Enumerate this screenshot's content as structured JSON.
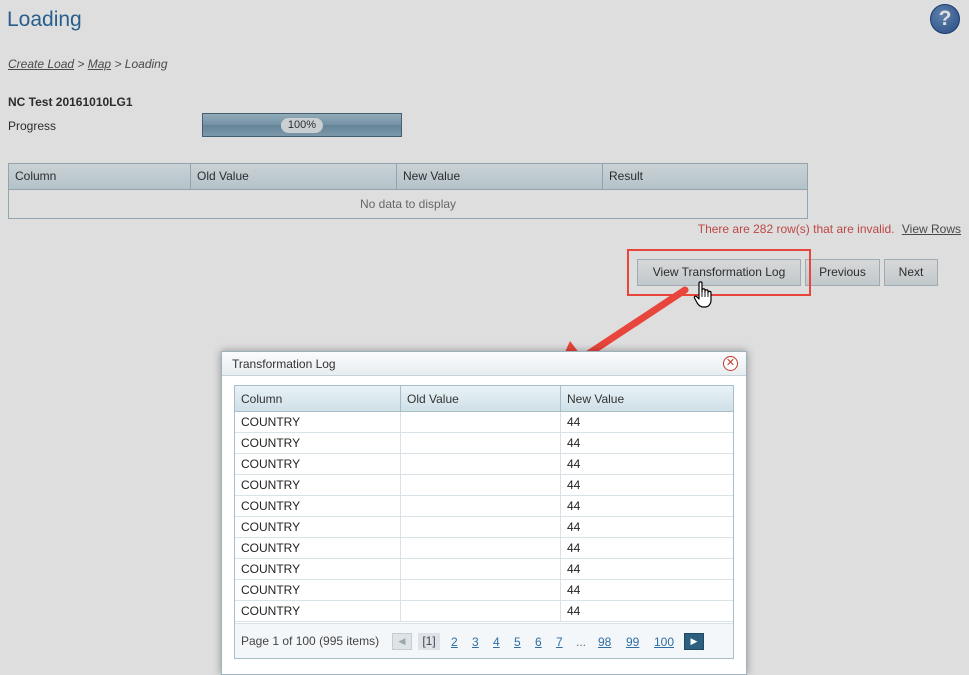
{
  "page": {
    "title": "Loading",
    "help_icon": "question-mark-icon"
  },
  "breadcrumb": {
    "items": [
      "Create Load",
      "Map"
    ],
    "separator": ">",
    "current": "Loading"
  },
  "load": {
    "name": "NC Test 20161010LG1",
    "progress_label": "Progress",
    "progress_value": 100,
    "progress_text": "100%"
  },
  "results_grid": {
    "columns": [
      "Column",
      "Old Value",
      "New Value",
      "Result"
    ],
    "empty_message": "No data to display"
  },
  "validation": {
    "message": "There are 282 row(s) that are invalid.",
    "link": "View Rows"
  },
  "actions": {
    "view_log": "View Transformation Log",
    "previous": "Previous",
    "next": "Next"
  },
  "modal": {
    "title": "Transformation Log",
    "close_icon": "close-icon",
    "columns": [
      "Column",
      "Old Value",
      "New Value"
    ],
    "rows": [
      {
        "column": "COUNTRY",
        "old": "",
        "new": "44"
      },
      {
        "column": "COUNTRY",
        "old": "",
        "new": "44"
      },
      {
        "column": "COUNTRY",
        "old": "",
        "new": "44"
      },
      {
        "column": "COUNTRY",
        "old": "",
        "new": "44"
      },
      {
        "column": "COUNTRY",
        "old": "",
        "new": "44"
      },
      {
        "column": "COUNTRY",
        "old": "",
        "new": "44"
      },
      {
        "column": "COUNTRY",
        "old": "",
        "new": "44"
      },
      {
        "column": "COUNTRY",
        "old": "",
        "new": "44"
      },
      {
        "column": "COUNTRY",
        "old": "",
        "new": "44"
      },
      {
        "column": "COUNTRY",
        "old": "",
        "new": "44"
      }
    ],
    "pager": {
      "info": "Page 1 of 100 (995 items)",
      "current": "[1]",
      "pages": [
        "2",
        "3",
        "4",
        "5",
        "6",
        "7"
      ],
      "ellipsis": "...",
      "last_pages": [
        "98",
        "99",
        "100"
      ],
      "prev_icon": "chevron-left-icon",
      "next_icon": "chevron-right-icon"
    }
  },
  "colors": {
    "title_blue": "#2e6da4",
    "invalid_red": "#d9534f",
    "highlight_red": "#e8453c"
  }
}
